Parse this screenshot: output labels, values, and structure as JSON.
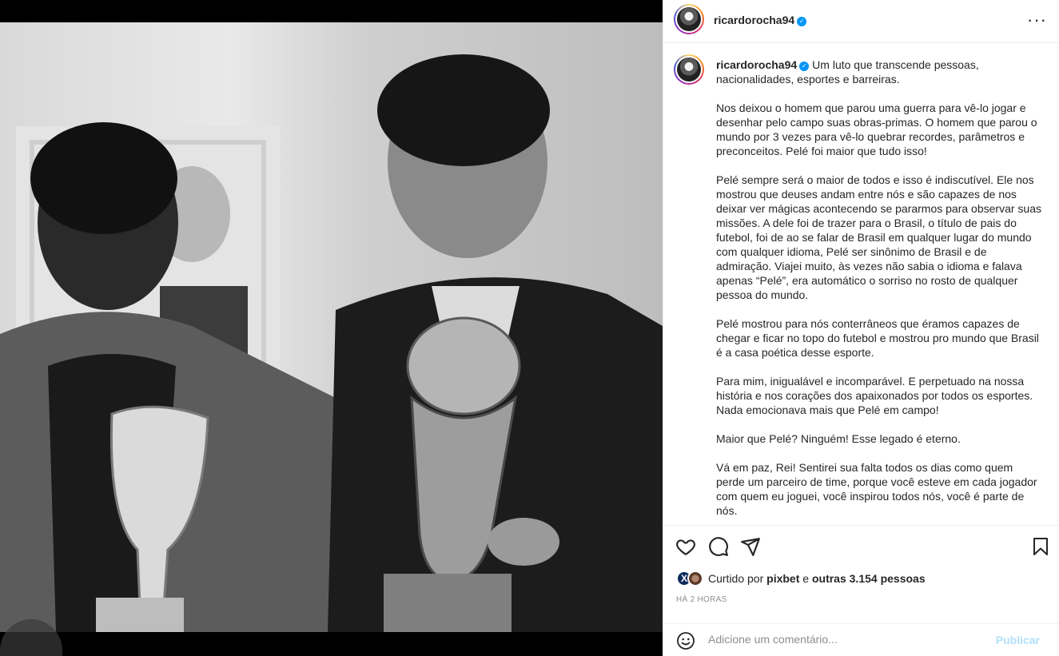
{
  "post": {
    "username": "ricardorocha94",
    "verified_icon": "verified-badge-icon",
    "more_icon": "more-options-icon"
  },
  "caption": {
    "username": "ricardorocha94",
    "paragraphs": [
      "Um luto que transcende pessoas, nacionalidades, esportes e barreiras.",
      "Nos deixou o homem que parou uma guerra para vê-lo jogar e desenhar pelo campo suas obras-primas. O homem que parou o mundo por 3 vezes para vê-lo quebrar recordes, parâmetros e preconceitos. Pelé foi maior que tudo isso!",
      "Pelé sempre será o maior de todos e isso é indiscutível. Ele nos mostrou que deuses andam entre nós e são capazes de nos deixar ver mágicas acontecendo se pararmos para observar suas missões. A dele foi de trazer para o Brasil, o título de pais do futebol, foi de ao se falar de Brasil em qualquer lugar do mundo com qualquer idioma, Pelé ser sinônimo de Brasil e de admiração. Viajei muito, às vezes não sabia o idioma e falava apenas “Pelé”, era automático o sorriso no rosto de qualquer pessoa do mundo.",
      "Pelé mostrou para nós conterrâneos que éramos capazes de chegar e ficar no topo do futebol e mostrou pro mundo que Brasil é a casa poética desse esporte.",
      "Para mim, inigualável e incomparável. E perpetuado na nossa história e nos corações dos apaixonados por todos os esportes. Nada emocionava mais que Pelé em campo!",
      "Maior que Pelé? Ninguém! Esse legado é eterno.",
      "Vá em paz, Rei! Sentirei sua falta todos os dias como quem perde um parceiro de time, porque você esteve em cada jogador com quem eu joguei, você inspirou todos nós, você é parte de nós."
    ]
  },
  "actions": {
    "like_icon": "heart-icon",
    "comment_icon": "comment-icon",
    "share_icon": "share-icon",
    "save_icon": "bookmark-icon"
  },
  "likes": {
    "prefix": "Curtido por",
    "user": "pixbet",
    "connector": "e",
    "others": "outras 3.154 pessoas",
    "avatar_letter": "X"
  },
  "timestamp": "HÁ 2 HORAS",
  "comment": {
    "placeholder": "Adicione um comentário...",
    "publish_label": "Publicar",
    "emoji_icon": "emoji-icon"
  },
  "colors": {
    "verified": "#0095f6",
    "publish_disabled": "#b2dffc",
    "border": "#efefef",
    "muted": "#8e8e8e"
  }
}
